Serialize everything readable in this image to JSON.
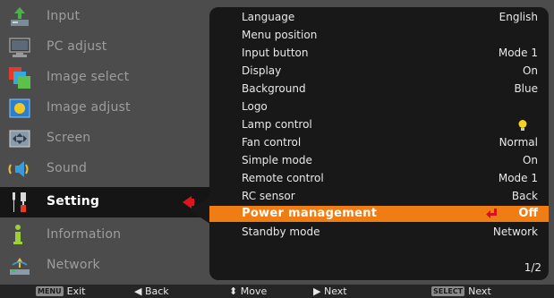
{
  "left_menu": {
    "items": [
      {
        "label": "Input",
        "icon": "input-icon"
      },
      {
        "label": "PC adjust",
        "icon": "pc-adjust-icon"
      },
      {
        "label": "Image select",
        "icon": "image-select-icon"
      },
      {
        "label": "Image adjust",
        "icon": "image-adjust-icon"
      },
      {
        "label": "Screen",
        "icon": "screen-icon"
      },
      {
        "label": "Sound",
        "icon": "sound-icon"
      },
      {
        "label": "Setting",
        "icon": "setting-icon"
      },
      {
        "label": "Information",
        "icon": "information-icon"
      },
      {
        "label": "Network",
        "icon": "network-icon"
      }
    ],
    "selected": "Setting"
  },
  "settings": {
    "rows": [
      {
        "label": "Language",
        "value": "English"
      },
      {
        "label": "Menu position",
        "value": ""
      },
      {
        "label": "Input button",
        "value": "Mode 1"
      },
      {
        "label": "Display",
        "value": "On"
      },
      {
        "label": "Background",
        "value": "Blue"
      },
      {
        "label": "Logo",
        "value": ""
      },
      {
        "label": "Lamp control",
        "value": "",
        "icon": "lamp-bulb-icon"
      },
      {
        "label": "Fan control",
        "value": "Normal"
      },
      {
        "label": "Simple mode",
        "value": "On"
      },
      {
        "label": "Remote control",
        "value": "Mode 1"
      },
      {
        "label": "RC sensor",
        "value": "Back"
      },
      {
        "label": "Power management",
        "value": "Off"
      },
      {
        "label": "Standby mode",
        "value": "Network"
      }
    ],
    "highlighted": "Power management",
    "page": "1/2"
  },
  "bottom_bar": {
    "exit": {
      "key": "MENU",
      "label": "Exit"
    },
    "back": {
      "symbol": "◀",
      "label": "Back"
    },
    "move": {
      "symbol": "⬍",
      "label": "Move"
    },
    "next": {
      "symbol": "▶",
      "label": "Next"
    },
    "select": {
      "key": "SELECT",
      "label": "Next"
    }
  },
  "colors": {
    "highlight": "#f07d14",
    "selection_arrow": "#e0141e",
    "panel_bg": "#181818",
    "frame_bg": "#4c4c4c"
  }
}
